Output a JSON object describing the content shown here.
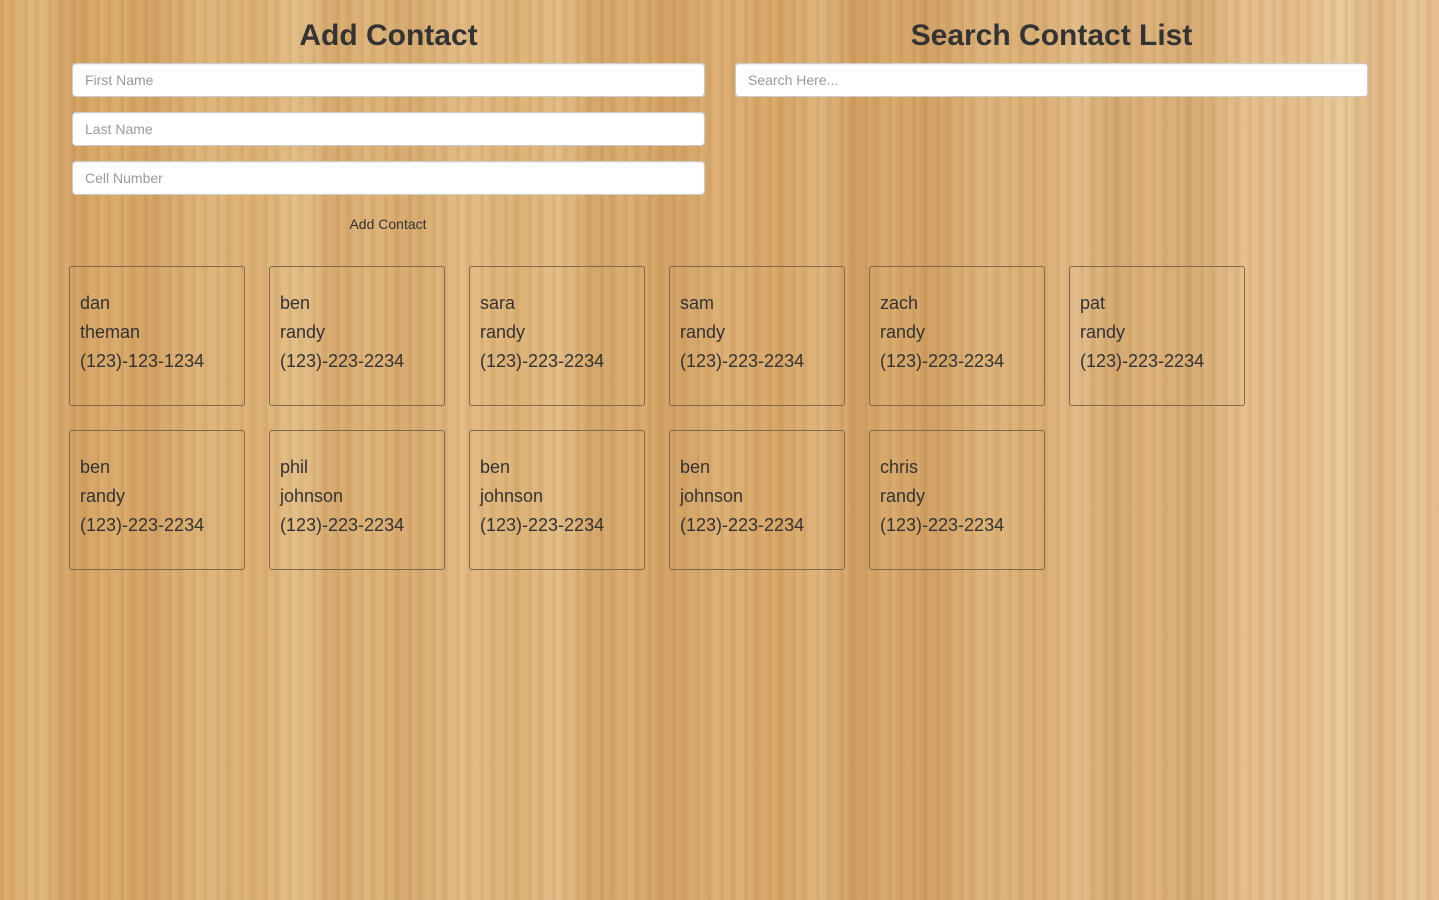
{
  "add_contact": {
    "title": "Add Contact",
    "first_name_placeholder": "First Name",
    "last_name_placeholder": "Last Name",
    "cell_number_placeholder": "Cell Number",
    "button_label": "Add Contact"
  },
  "search": {
    "title": "Search Contact List",
    "placeholder": "Search Here..."
  },
  "contacts": [
    {
      "first": "dan",
      "last": "theman",
      "phone": "(123)-123-1234"
    },
    {
      "first": "ben",
      "last": "randy",
      "phone": "(123)-223-2234"
    },
    {
      "first": "sara",
      "last": "randy",
      "phone": "(123)-223-2234"
    },
    {
      "first": "sam",
      "last": "randy",
      "phone": "(123)-223-2234"
    },
    {
      "first": "zach",
      "last": "randy",
      "phone": "(123)-223-2234"
    },
    {
      "first": "pat",
      "last": "randy",
      "phone": "(123)-223-2234"
    },
    {
      "first": "ben",
      "last": "randy",
      "phone": "(123)-223-2234"
    },
    {
      "first": "phil",
      "last": "johnson",
      "phone": "(123)-223-2234"
    },
    {
      "first": "ben",
      "last": "johnson",
      "phone": "(123)-223-2234"
    },
    {
      "first": "ben",
      "last": "johnson",
      "phone": "(123)-223-2234"
    },
    {
      "first": "chris",
      "last": "randy",
      "phone": "(123)-223-2234"
    }
  ]
}
